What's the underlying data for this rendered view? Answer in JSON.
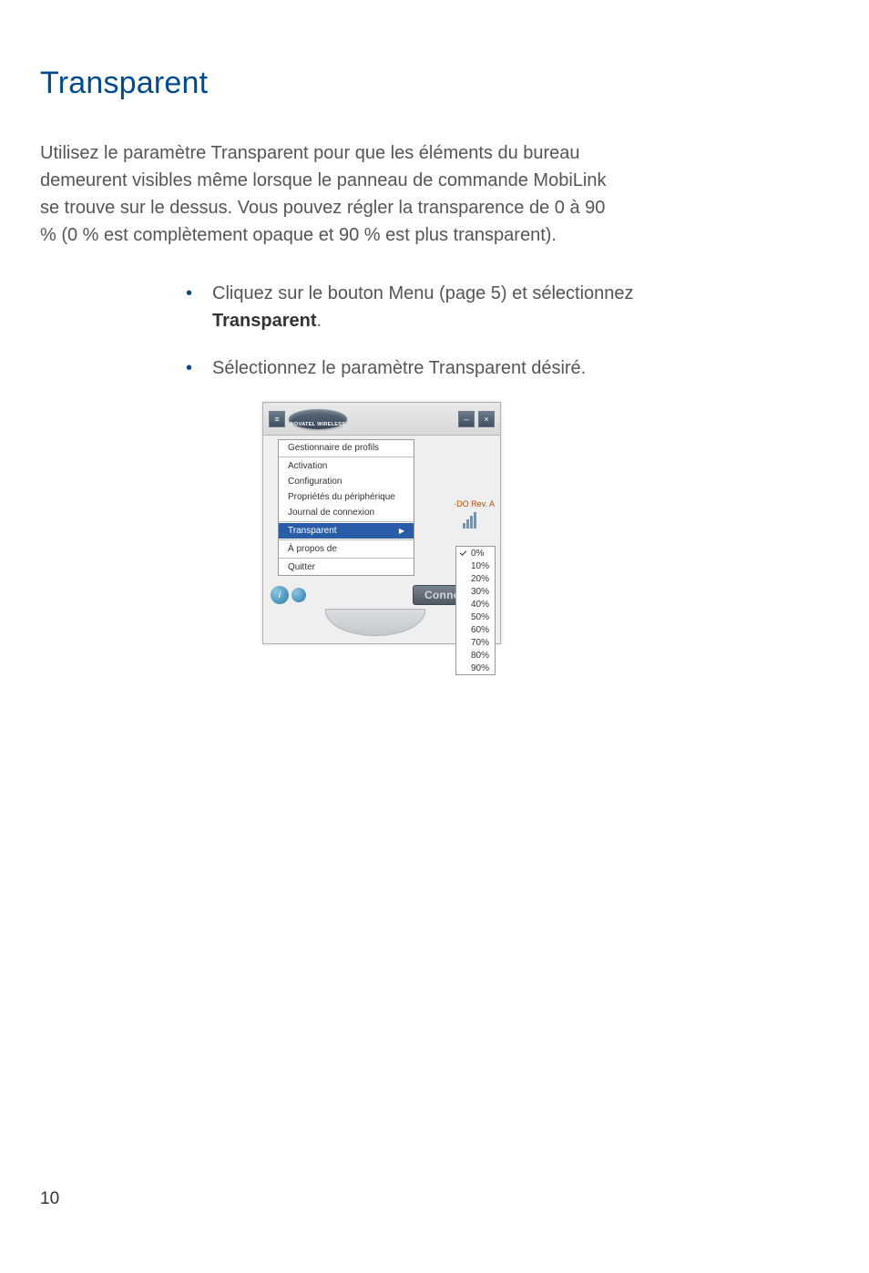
{
  "heading": "Transparent",
  "intro": "Utilisez le paramètre Transparent pour que les éléments du bureau demeurent visibles même lorsque le panneau de commande MobiLink se trouve sur le dessus. Vous pouvez régler la transparence de 0 à 90 % (0 % est complètement opaque et 90 % est plus transparent).",
  "bullet1_pre": "Cliquez sur le bouton Menu (page 5) et sélec­tionnez ",
  "bullet1_bold": "Transparent",
  "bullet1_post": ".",
  "bullet2": "Sélectionnez le paramètre Transparent désiré.",
  "screenshot": {
    "logo_text": "NOVATEL WIRELESS",
    "menu": {
      "profiles": "Gestionnaire de profils",
      "activation": "Activation",
      "config": "Configuration",
      "props": "Propriétés du périphérique",
      "journal": "Journal de connexion",
      "transparent": "Transparent",
      "about": "À propos de",
      "quit": "Quitter"
    },
    "rev_label": "·DO Rev. A",
    "connect_button": "Connecter",
    "submenu": [
      "0%",
      "10%",
      "20%",
      "30%",
      "40%",
      "50%",
      "60%",
      "70%",
      "80%",
      "90%"
    ],
    "submenu_selected_index": 0
  },
  "page_number": "10"
}
